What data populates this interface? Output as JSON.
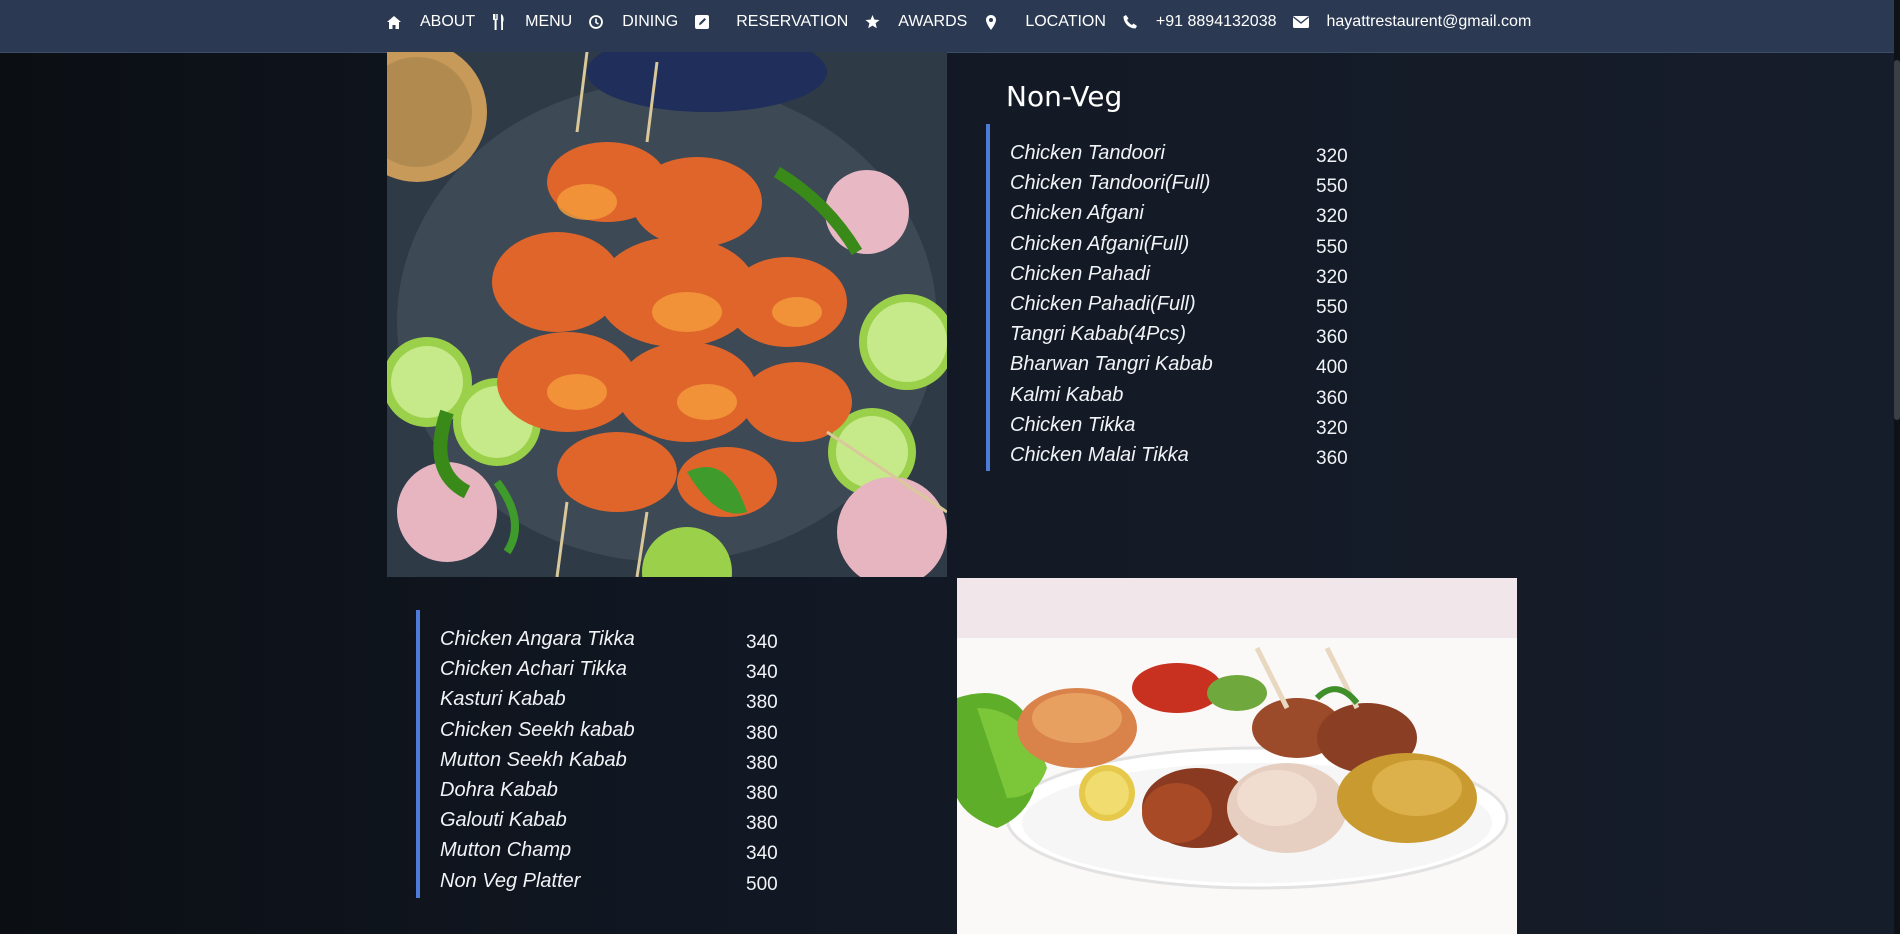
{
  "nav": {
    "items": [
      {
        "label": "ABOUT",
        "icon": "home-icon"
      },
      {
        "label": "MENU",
        "icon": "utensils-icon"
      },
      {
        "label": "DINING",
        "icon": "clock-icon"
      },
      {
        "label": "RESERVATION",
        "icon": "edit-icon"
      },
      {
        "label": "AWARDS",
        "icon": "star-icon"
      },
      {
        "label": "LOCATION",
        "icon": "map-marker-icon"
      },
      {
        "label": "+91 8894132038",
        "icon": "phone-icon"
      },
      {
        "label": "hayattrestaurent@gmail.com",
        "icon": "envelope-icon"
      }
    ]
  },
  "section_title": "Non-Veg",
  "menu_one": [
    {
      "name": "Chicken Tandoori",
      "price": "320"
    },
    {
      "name": "Chicken Tandoori(Full)",
      "price": "550"
    },
    {
      "name": "Chicken Afgani",
      "price": "320"
    },
    {
      "name": "Chicken Afgani(Full)",
      "price": "550"
    },
    {
      "name": "Chicken Pahadi",
      "price": "320"
    },
    {
      "name": "Chicken Pahadi(Full)",
      "price": "550"
    },
    {
      "name": "Tangri Kabab(4Pcs)",
      "price": "360"
    },
    {
      "name": "Bharwan Tangri Kabab",
      "price": "400"
    },
    {
      "name": "Kalmi Kabab",
      "price": "360"
    },
    {
      "name": "Chicken Tikka",
      "price": "320"
    },
    {
      "name": "Chicken Malai Tikka",
      "price": "360"
    }
  ],
  "menu_two": [
    {
      "name": "Chicken Angara Tikka",
      "price": "340"
    },
    {
      "name": "Chicken Achari Tikka",
      "price": "340"
    },
    {
      "name": "Kasturi Kabab",
      "price": "380"
    },
    {
      "name": "Chicken Seekh kabab",
      "price": "380"
    },
    {
      "name": "Mutton Seekh Kabab",
      "price": "380"
    },
    {
      "name": "Dohra Kabab",
      "price": "380"
    },
    {
      "name": "Galouti Kabab",
      "price": "380"
    },
    {
      "name": "Mutton Champ",
      "price": "340"
    },
    {
      "name": "Non Veg Platter",
      "price": "500"
    }
  ],
  "colors": {
    "nav_bg": "#2b3a52",
    "accent_border": "#4d7bd8"
  }
}
